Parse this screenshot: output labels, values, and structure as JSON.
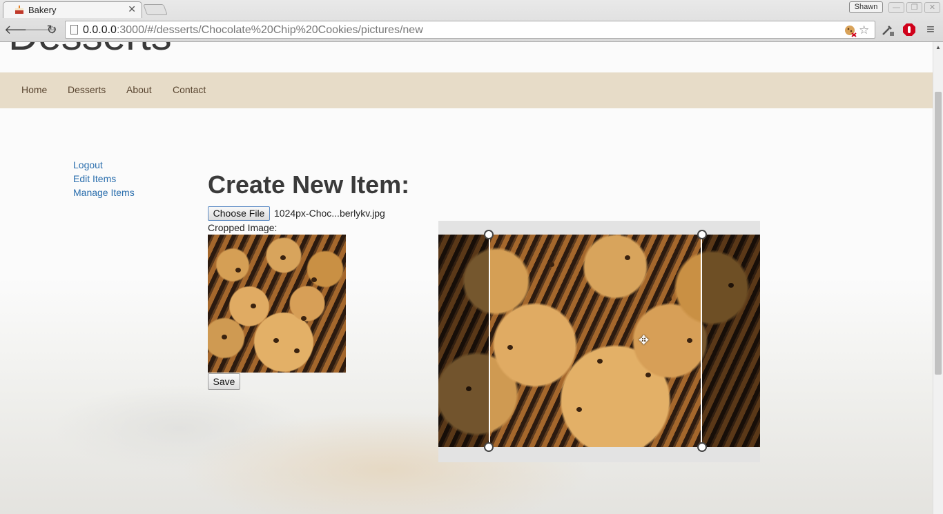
{
  "browser": {
    "tab_title": "Bakery",
    "tab_close": "✕",
    "profile_name": "Shawn",
    "url_host": "0.0.0.0",
    "url_rest": ":3000/#/desserts/Chocolate%20Chip%20Cookies/pictures/new",
    "back_icon": "🡐",
    "forward_icon": "🡒",
    "reload_icon": "↻",
    "star_icon": "☆",
    "menu_icon": "≡",
    "window_buttons": [
      "—",
      "❐",
      "✕"
    ]
  },
  "site": {
    "brand": "Desserts",
    "nav": [
      "Home",
      "Desserts",
      "About",
      "Contact"
    ]
  },
  "sidebar": {
    "links": [
      "Logout",
      "Edit Items",
      "Manage Items"
    ]
  },
  "form": {
    "heading": "Create New Item:",
    "choose_file_label": "Choose File",
    "file_name": "1024px-Choc...berlykv.jpg",
    "cropped_label": "Cropped Image:",
    "save_label": "Save",
    "move_cursor": "✥"
  },
  "colors": {
    "navbar_bg": "#e7dcc8",
    "link": "#2a6ead"
  }
}
